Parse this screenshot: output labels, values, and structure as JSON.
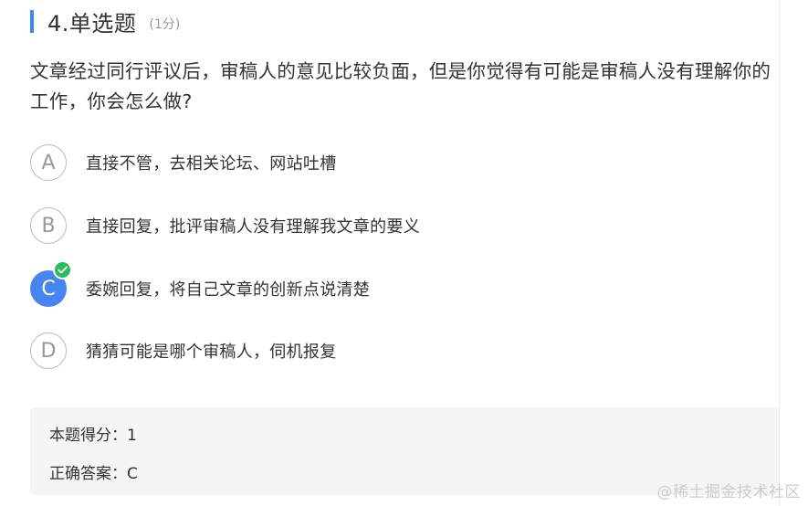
{
  "question": {
    "number_title": "4.单选题",
    "score": "(1分)",
    "text": "文章经过同行评议后，审稿人的意见比较负面，但是你觉得有可能是审稿人没有理解你的工作，你会怎么做?"
  },
  "options": [
    {
      "letter": "A",
      "text": "直接不管，去相关论坛、网站吐槽"
    },
    {
      "letter": "B",
      "text": "直接回复，批评审稿人没有理解我文章的要义"
    },
    {
      "letter": "C",
      "text": "委婉回复，将自己文章的创新点说清楚"
    },
    {
      "letter": "D",
      "text": "猜猜可能是哪个审稿人，伺机报复"
    }
  ],
  "selected_option": "C",
  "result": {
    "score_line": "本题得分：1",
    "answer_line": "正确答案：C"
  },
  "watermark": "@稀土掘金技术社区",
  "icons": {
    "correct": "check-circle-icon"
  },
  "colors": {
    "accent": "#3d87f1",
    "selected": "#4586f0",
    "correct": "#2bba5a"
  }
}
